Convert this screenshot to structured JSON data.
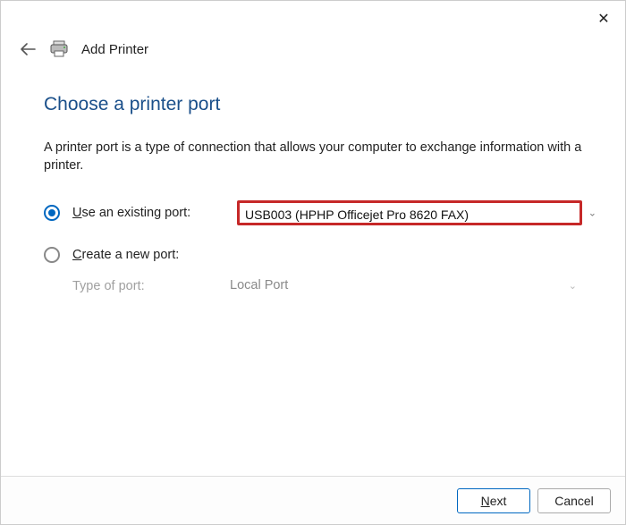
{
  "window": {
    "wizard_title": "Add Printer"
  },
  "page": {
    "heading": "Choose a printer port",
    "description": "A printer port is a type of connection that allows your computer to exchange information with a printer."
  },
  "options": {
    "existing": {
      "label_prefix": "U",
      "label_rest": "se an existing port:",
      "value": "USB003 (HPHP Officejet Pro 8620 FAX)",
      "selected": true
    },
    "create": {
      "label_prefix": "C",
      "label_rest": "reate a new port:",
      "type_label": "Type of port:",
      "type_value": "Local Port",
      "selected": false
    }
  },
  "footer": {
    "next_prefix": "N",
    "next_rest": "ext",
    "cancel": "Cancel"
  }
}
